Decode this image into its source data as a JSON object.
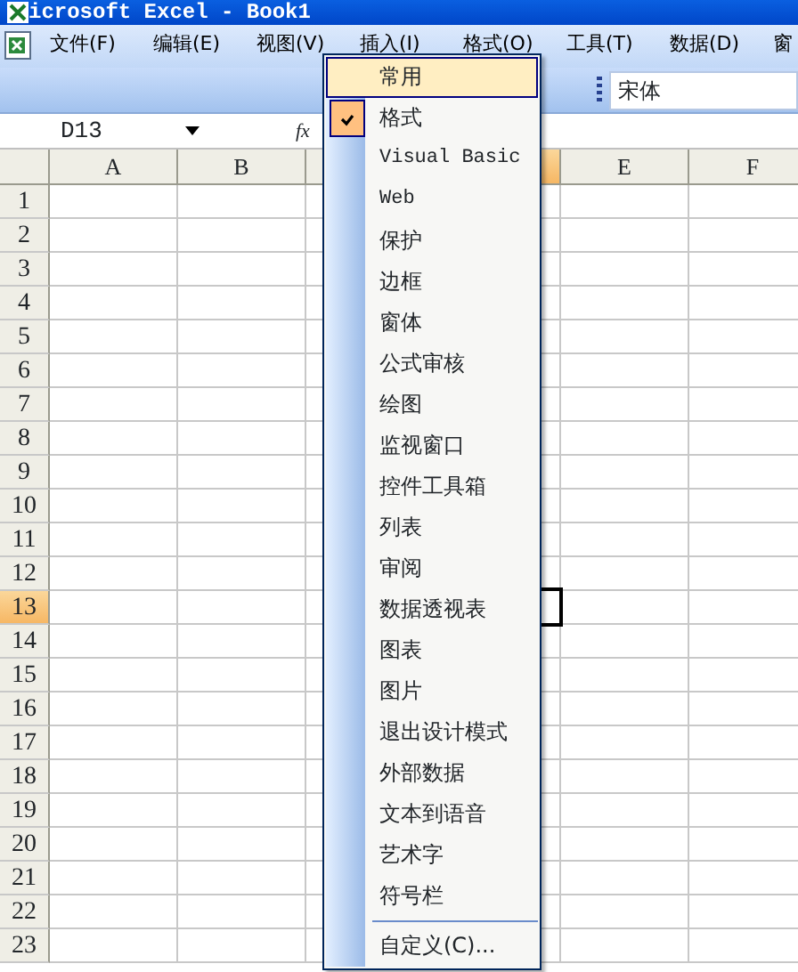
{
  "window": {
    "title": "icrosoft Excel - Book1"
  },
  "menu_bar": [
    {
      "label": "文件(F)"
    },
    {
      "label": "编辑(E)"
    },
    {
      "label": "视图(V)"
    },
    {
      "label": "插入(I)"
    },
    {
      "label": "格式(O)"
    },
    {
      "label": "工具(T)"
    },
    {
      "label": "数据(D)"
    },
    {
      "label": "窗"
    }
  ],
  "toolbar": {
    "font_name": "宋体"
  },
  "formula_bar": {
    "name_box": "D13",
    "fx": "fx"
  },
  "sheet": {
    "columns": [
      {
        "label": "A",
        "selected": false
      },
      {
        "label": "B",
        "selected": false
      },
      {
        "selected": false
      },
      {
        "selected": true
      },
      {
        "label": "E",
        "selected": false
      },
      {
        "label": "F",
        "selected": false
      }
    ],
    "rows": [
      {
        "label": "1",
        "selected": false
      },
      {
        "label": "2",
        "selected": false
      },
      {
        "label": "3",
        "selected": false
      },
      {
        "label": "4",
        "selected": false
      },
      {
        "label": "5",
        "selected": false
      },
      {
        "label": "6",
        "selected": false
      },
      {
        "label": "7",
        "selected": false
      },
      {
        "label": "8",
        "selected": false
      },
      {
        "label": "9",
        "selected": false
      },
      {
        "label": "10",
        "selected": false
      },
      {
        "label": "11",
        "selected": false
      },
      {
        "label": "12",
        "selected": false
      },
      {
        "label": "13",
        "selected": true
      },
      {
        "label": "14",
        "selected": false
      },
      {
        "label": "15",
        "selected": false
      },
      {
        "label": "16",
        "selected": false
      },
      {
        "label": "17",
        "selected": false
      },
      {
        "label": "18",
        "selected": false
      },
      {
        "label": "19",
        "selected": false
      },
      {
        "label": "20",
        "selected": false
      },
      {
        "label": "21",
        "selected": false
      },
      {
        "label": "22",
        "selected": false
      },
      {
        "label": "23",
        "selected": false
      }
    ]
  },
  "toolbar_menu": {
    "items": [
      {
        "label": "常用",
        "checked": false,
        "selected": true
      },
      {
        "label": "格式",
        "checked": true,
        "selected": false
      },
      {
        "label": "Visual Basic",
        "checked": false,
        "selected": false
      },
      {
        "label": "Web",
        "checked": false,
        "selected": false
      },
      {
        "label": "保护",
        "checked": false,
        "selected": false
      },
      {
        "label": "边框",
        "checked": false,
        "selected": false
      },
      {
        "label": "窗体",
        "checked": false,
        "selected": false
      },
      {
        "label": "公式审核",
        "checked": false,
        "selected": false
      },
      {
        "label": "绘图",
        "checked": false,
        "selected": false
      },
      {
        "label": "监视窗口",
        "checked": false,
        "selected": false
      },
      {
        "label": "控件工具箱",
        "checked": false,
        "selected": false
      },
      {
        "label": "列表",
        "checked": false,
        "selected": false
      },
      {
        "label": "审阅",
        "checked": false,
        "selected": false
      },
      {
        "label": "数据透视表",
        "checked": false,
        "selected": false
      },
      {
        "label": "图表",
        "checked": false,
        "selected": false
      },
      {
        "label": "图片",
        "checked": false,
        "selected": false
      },
      {
        "label": "退出设计模式",
        "checked": false,
        "selected": false
      },
      {
        "label": "外部数据",
        "checked": false,
        "selected": false
      },
      {
        "label": "文本到语音",
        "checked": false,
        "selected": false
      },
      {
        "label": "艺术字",
        "checked": false,
        "selected": false
      },
      {
        "label": "符号栏",
        "checked": false,
        "selected": false
      }
    ],
    "customize": "自定义(C)..."
  }
}
